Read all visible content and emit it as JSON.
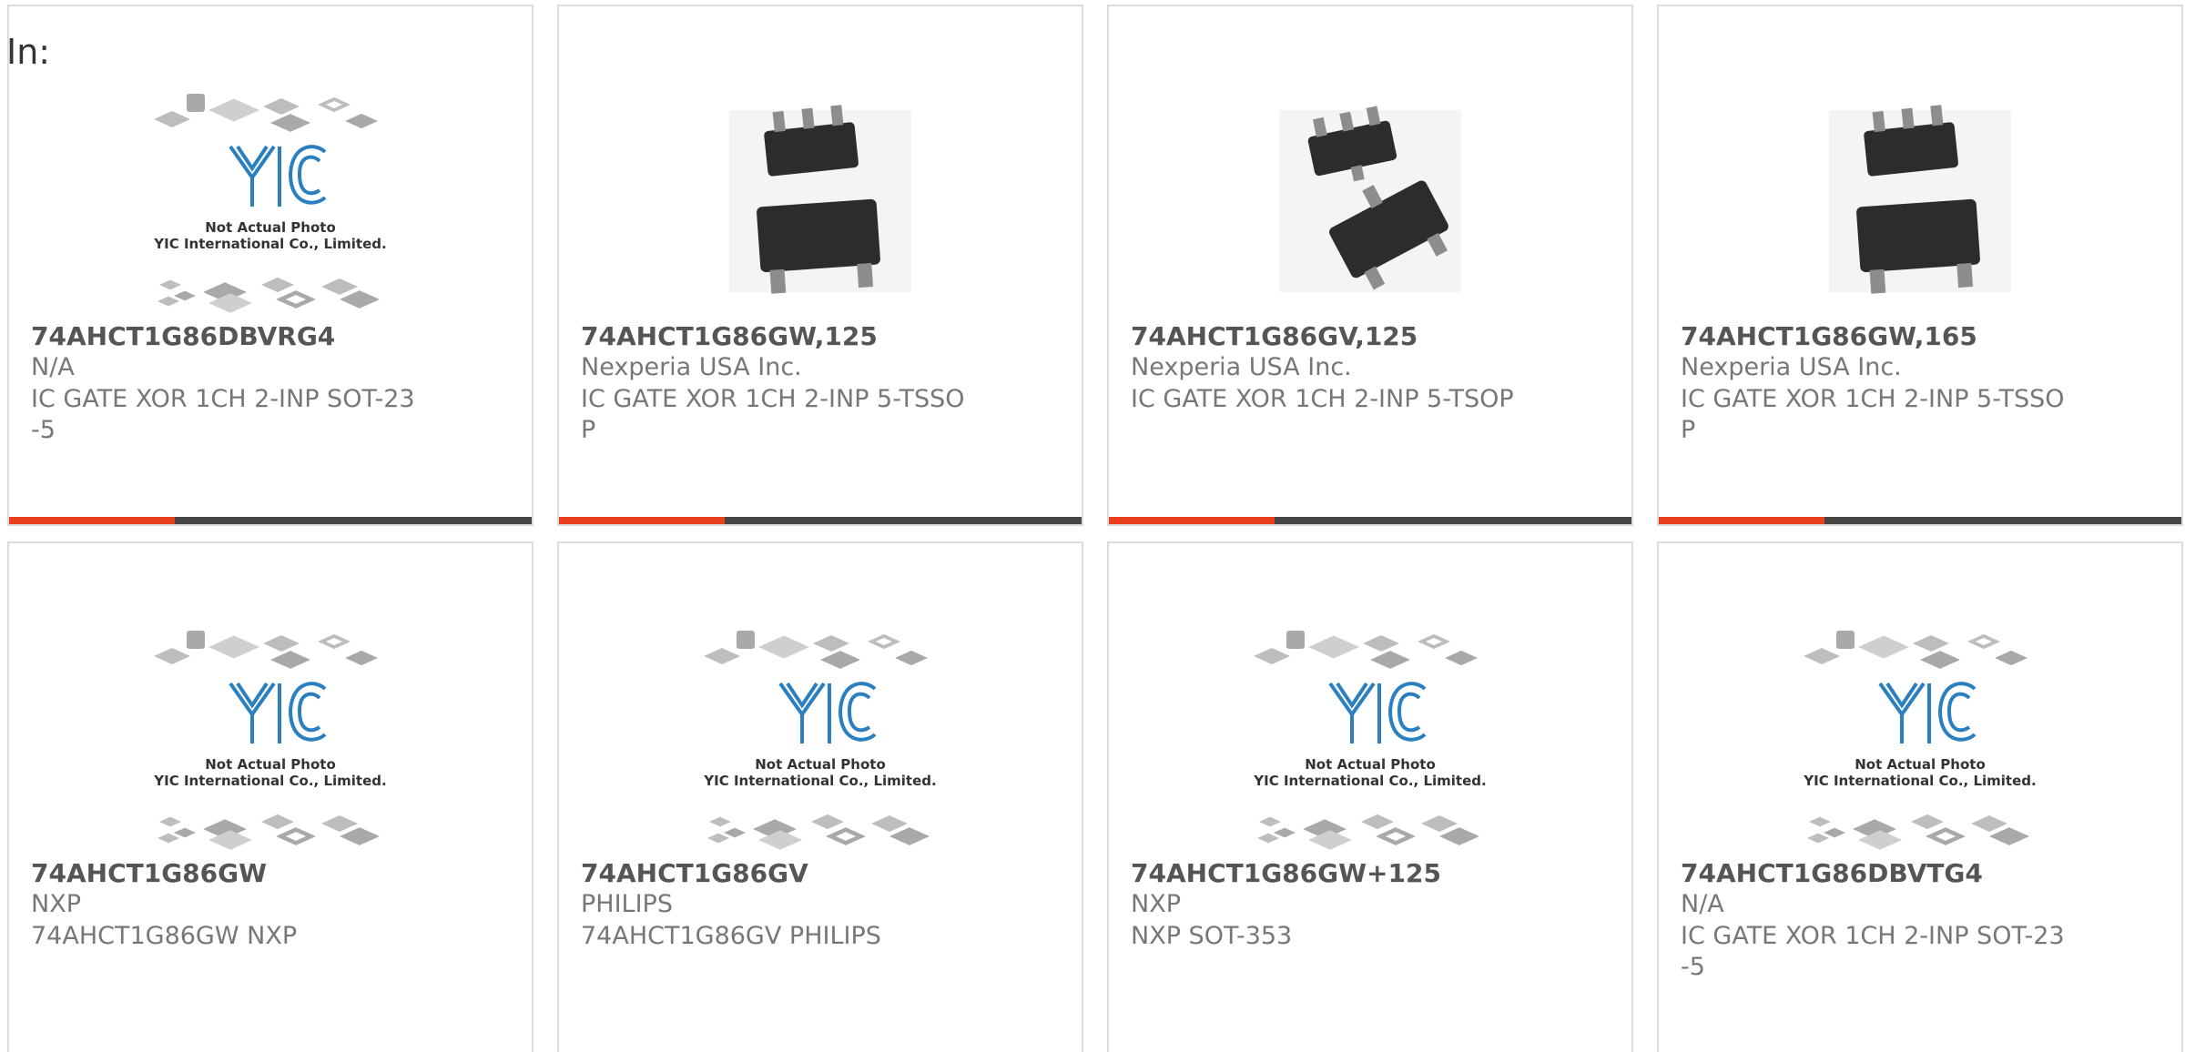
{
  "heading": "In:",
  "placeholder_image": {
    "line1": "Not Actual Photo",
    "line2": "YIC International Co., Limited.",
    "logo": "YIC"
  },
  "colors": {
    "accent": "#e8401c",
    "bar": "#454545",
    "border": "#dcdcdc",
    "logo_blue": "#2a7fc0"
  },
  "products": [
    {
      "part": "74AHCT1G86DBVRG4",
      "maker": "N/A",
      "desc": "IC GATE XOR 1CH 2-INP SOT-23-5",
      "image": "placeholder"
    },
    {
      "part": "74AHCT1G86GW,125",
      "maker": "Nexperia USA Inc.",
      "desc": "IC GATE XOR 1CH 2-INP 5-TSSOP",
      "image": "sot-package-photo"
    },
    {
      "part": "74AHCT1G86GV,125",
      "maker": "Nexperia USA Inc.",
      "desc": "IC GATE XOR 1CH 2-INP 5-TSOP",
      "image": "sot-package-photo"
    },
    {
      "part": "74AHCT1G86GW,165",
      "maker": "Nexperia USA Inc.",
      "desc": "IC GATE XOR 1CH 2-INP 5-TSSOP",
      "image": "sot-package-photo"
    },
    {
      "part": "74AHCT1G86GW",
      "maker": "NXP",
      "desc": "74AHCT1G86GW NXP",
      "image": "placeholder"
    },
    {
      "part": "74AHCT1G86GV",
      "maker": "PHILIPS",
      "desc": "74AHCT1G86GV PHILIPS",
      "image": "placeholder"
    },
    {
      "part": "74AHCT1G86GW+125",
      "maker": "NXP",
      "desc": "NXP SOT-353",
      "image": "placeholder"
    },
    {
      "part": "74AHCT1G86DBVTG4",
      "maker": "N/A",
      "desc": "IC GATE XOR 1CH 2-INP SOT-23-5",
      "image": "placeholder"
    }
  ]
}
